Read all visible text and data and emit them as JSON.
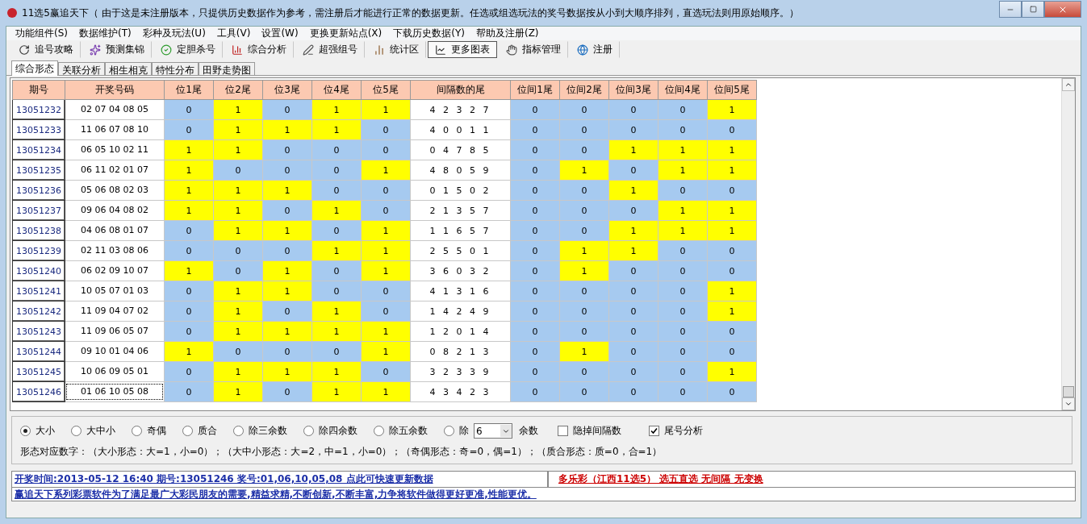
{
  "window": {
    "title": "11选5赢追天下（ 由于这是未注册版本，只提供历史数据作为参考，需注册后才能进行正常的数据更新。任选或组选玩法的奖号数据按从小到大顺序排列，直选玩法则用原始顺序。）"
  },
  "menu": [
    "功能组件(S)",
    "数据维护(T)",
    "彩种及玩法(U)",
    "工具(V)",
    "设置(W)",
    "更换更新站点(X)",
    "下载历史数据(Y)",
    "帮助及注册(Z)"
  ],
  "toolbar": [
    {
      "label": "追号攻略",
      "kind": "refresh",
      "pressed": false
    },
    {
      "label": "预测集锦",
      "kind": "scatter",
      "pressed": false
    },
    {
      "label": "定胆杀号",
      "kind": "check",
      "pressed": false
    },
    {
      "label": "综合分析",
      "kind": "bars",
      "pressed": false
    },
    {
      "label": "超强组号",
      "kind": "pen",
      "pressed": false
    },
    {
      "label": "统计区",
      "kind": "stats",
      "pressed": false
    },
    {
      "label": "更多图表",
      "kind": "chart",
      "pressed": true
    },
    {
      "label": "指标管理",
      "kind": "hand",
      "pressed": false
    },
    {
      "label": "注册",
      "kind": "globe",
      "pressed": false
    }
  ],
  "tabs": [
    {
      "label": "综合形态",
      "selected": true
    },
    {
      "label": "关联分析",
      "selected": false
    },
    {
      "label": "相生相克",
      "selected": false
    },
    {
      "label": "特性分布",
      "selected": false
    },
    {
      "label": "田野走势图",
      "selected": false
    }
  ],
  "table": {
    "columns": [
      "期号",
      "开奖号码",
      "位1尾",
      "位2尾",
      "位3尾",
      "位4尾",
      "位5尾",
      "间隔数的尾",
      "位间1尾",
      "位间2尾",
      "位间3尾",
      "位间4尾",
      "位间5尾"
    ],
    "rows": [
      {
        "period": "13051232",
        "numbers": "02 07 04 08 05",
        "focused": false,
        "tails": [
          {
            "value": "0",
            "hit": false
          },
          {
            "value": "1",
            "hit": true
          },
          {
            "value": "0",
            "hit": false
          },
          {
            "value": "1",
            "hit": true
          },
          {
            "value": "1",
            "hit": true
          }
        ],
        "gaps": "4 2 3 2 7",
        "gap_tails": [
          {
            "value": "0",
            "hit": false
          },
          {
            "value": "0",
            "hit": false
          },
          {
            "value": "0",
            "hit": false
          },
          {
            "value": "0",
            "hit": false
          },
          {
            "value": "1",
            "hit": true
          }
        ]
      },
      {
        "period": "13051233",
        "numbers": "11 06 07 08 10",
        "focused": false,
        "tails": [
          {
            "value": "0",
            "hit": false
          },
          {
            "value": "1",
            "hit": true
          },
          {
            "value": "1",
            "hit": true
          },
          {
            "value": "1",
            "hit": true
          },
          {
            "value": "0",
            "hit": false
          }
        ],
        "gaps": "4 0 0 1 1",
        "gap_tails": [
          {
            "value": "0",
            "hit": false
          },
          {
            "value": "0",
            "hit": false
          },
          {
            "value": "0",
            "hit": false
          },
          {
            "value": "0",
            "hit": false
          },
          {
            "value": "0",
            "hit": false
          }
        ]
      },
      {
        "period": "13051234",
        "numbers": "06 05 10 02 11",
        "focused": false,
        "tails": [
          {
            "value": "1",
            "hit": true
          },
          {
            "value": "1",
            "hit": true
          },
          {
            "value": "0",
            "hit": false
          },
          {
            "value": "0",
            "hit": false
          },
          {
            "value": "0",
            "hit": false
          }
        ],
        "gaps": "0 4 7 8 5",
        "gap_tails": [
          {
            "value": "0",
            "hit": false
          },
          {
            "value": "0",
            "hit": false
          },
          {
            "value": "1",
            "hit": true
          },
          {
            "value": "1",
            "hit": true
          },
          {
            "value": "1",
            "hit": true
          }
        ]
      },
      {
        "period": "13051235",
        "numbers": "06 11 02 01 07",
        "focused": false,
        "tails": [
          {
            "value": "1",
            "hit": true
          },
          {
            "value": "0",
            "hit": false
          },
          {
            "value": "0",
            "hit": false
          },
          {
            "value": "0",
            "hit": false
          },
          {
            "value": "1",
            "hit": true
          }
        ],
        "gaps": "4 8 0 5 9",
        "gap_tails": [
          {
            "value": "0",
            "hit": false
          },
          {
            "value": "1",
            "hit": true
          },
          {
            "value": "0",
            "hit": false
          },
          {
            "value": "1",
            "hit": true
          },
          {
            "value": "1",
            "hit": true
          }
        ]
      },
      {
        "period": "13051236",
        "numbers": "05 06 08 02 03",
        "focused": false,
        "tails": [
          {
            "value": "1",
            "hit": true
          },
          {
            "value": "1",
            "hit": true
          },
          {
            "value": "1",
            "hit": true
          },
          {
            "value": "0",
            "hit": false
          },
          {
            "value": "0",
            "hit": false
          }
        ],
        "gaps": "0 1 5 0 2",
        "gap_tails": [
          {
            "value": "0",
            "hit": false
          },
          {
            "value": "0",
            "hit": false
          },
          {
            "value": "1",
            "hit": true
          },
          {
            "value": "0",
            "hit": false
          },
          {
            "value": "0",
            "hit": false
          }
        ]
      },
      {
        "period": "13051237",
        "numbers": "09 06 04 08 02",
        "focused": false,
        "tails": [
          {
            "value": "1",
            "hit": true
          },
          {
            "value": "1",
            "hit": true
          },
          {
            "value": "0",
            "hit": false
          },
          {
            "value": "1",
            "hit": true
          },
          {
            "value": "0",
            "hit": false
          }
        ],
        "gaps": "2 1 3 5 7",
        "gap_tails": [
          {
            "value": "0",
            "hit": false
          },
          {
            "value": "0",
            "hit": false
          },
          {
            "value": "0",
            "hit": false
          },
          {
            "value": "1",
            "hit": true
          },
          {
            "value": "1",
            "hit": true
          }
        ]
      },
      {
        "period": "13051238",
        "numbers": "04 06 08 01 07",
        "focused": false,
        "tails": [
          {
            "value": "0",
            "hit": false
          },
          {
            "value": "1",
            "hit": true
          },
          {
            "value": "1",
            "hit": true
          },
          {
            "value": "0",
            "hit": false
          },
          {
            "value": "1",
            "hit": true
          }
        ],
        "gaps": "1 1 6 5 7",
        "gap_tails": [
          {
            "value": "0",
            "hit": false
          },
          {
            "value": "0",
            "hit": false
          },
          {
            "value": "1",
            "hit": true
          },
          {
            "value": "1",
            "hit": true
          },
          {
            "value": "1",
            "hit": true
          }
        ]
      },
      {
        "period": "13051239",
        "numbers": "02 11 03 08 06",
        "focused": false,
        "tails": [
          {
            "value": "0",
            "hit": false
          },
          {
            "value": "0",
            "hit": false
          },
          {
            "value": "0",
            "hit": false
          },
          {
            "value": "1",
            "hit": true
          },
          {
            "value": "1",
            "hit": true
          }
        ],
        "gaps": "2 5 5 0 1",
        "gap_tails": [
          {
            "value": "0",
            "hit": false
          },
          {
            "value": "1",
            "hit": true
          },
          {
            "value": "1",
            "hit": true
          },
          {
            "value": "0",
            "hit": false
          },
          {
            "value": "0",
            "hit": false
          }
        ]
      },
      {
        "period": "13051240",
        "numbers": "06 02 09 10 07",
        "focused": false,
        "tails": [
          {
            "value": "1",
            "hit": true
          },
          {
            "value": "0",
            "hit": false
          },
          {
            "value": "1",
            "hit": true
          },
          {
            "value": "0",
            "hit": false
          },
          {
            "value": "1",
            "hit": true
          }
        ],
        "gaps": "3 6 0 3 2",
        "gap_tails": [
          {
            "value": "0",
            "hit": false
          },
          {
            "value": "1",
            "hit": true
          },
          {
            "value": "0",
            "hit": false
          },
          {
            "value": "0",
            "hit": false
          },
          {
            "value": "0",
            "hit": false
          }
        ]
      },
      {
        "period": "13051241",
        "numbers": "10 05 07 01 03",
        "focused": false,
        "tails": [
          {
            "value": "0",
            "hit": false
          },
          {
            "value": "1",
            "hit": true
          },
          {
            "value": "1",
            "hit": true
          },
          {
            "value": "0",
            "hit": false
          },
          {
            "value": "0",
            "hit": false
          }
        ],
        "gaps": "4 1 3 1 6",
        "gap_tails": [
          {
            "value": "0",
            "hit": false
          },
          {
            "value": "0",
            "hit": false
          },
          {
            "value": "0",
            "hit": false
          },
          {
            "value": "0",
            "hit": false
          },
          {
            "value": "1",
            "hit": true
          }
        ]
      },
      {
        "period": "13051242",
        "numbers": "11 09 04 07 02",
        "focused": false,
        "tails": [
          {
            "value": "0",
            "hit": false
          },
          {
            "value": "1",
            "hit": true
          },
          {
            "value": "0",
            "hit": false
          },
          {
            "value": "1",
            "hit": true
          },
          {
            "value": "0",
            "hit": false
          }
        ],
        "gaps": "1 4 2 4 9",
        "gap_tails": [
          {
            "value": "0",
            "hit": false
          },
          {
            "value": "0",
            "hit": false
          },
          {
            "value": "0",
            "hit": false
          },
          {
            "value": "0",
            "hit": false
          },
          {
            "value": "1",
            "hit": true
          }
        ]
      },
      {
        "period": "13051243",
        "numbers": "11 09 06 05 07",
        "focused": false,
        "tails": [
          {
            "value": "0",
            "hit": false
          },
          {
            "value": "1",
            "hit": true
          },
          {
            "value": "1",
            "hit": true
          },
          {
            "value": "1",
            "hit": true
          },
          {
            "value": "1",
            "hit": true
          }
        ],
        "gaps": "1 2 0 1 4",
        "gap_tails": [
          {
            "value": "0",
            "hit": false
          },
          {
            "value": "0",
            "hit": false
          },
          {
            "value": "0",
            "hit": false
          },
          {
            "value": "0",
            "hit": false
          },
          {
            "value": "0",
            "hit": false
          }
        ]
      },
      {
        "period": "13051244",
        "numbers": "09 10 01 04 06",
        "focused": false,
        "tails": [
          {
            "value": "1",
            "hit": true
          },
          {
            "value": "0",
            "hit": false
          },
          {
            "value": "0",
            "hit": false
          },
          {
            "value": "0",
            "hit": false
          },
          {
            "value": "1",
            "hit": true
          }
        ],
        "gaps": "0 8 2 1 3",
        "gap_tails": [
          {
            "value": "0",
            "hit": false
          },
          {
            "value": "1",
            "hit": true
          },
          {
            "value": "0",
            "hit": false
          },
          {
            "value": "0",
            "hit": false
          },
          {
            "value": "0",
            "hit": false
          }
        ]
      },
      {
        "period": "13051245",
        "numbers": "10 06 09 05 01",
        "focused": false,
        "tails": [
          {
            "value": "0",
            "hit": false
          },
          {
            "value": "1",
            "hit": true
          },
          {
            "value": "1",
            "hit": true
          },
          {
            "value": "1",
            "hit": true
          },
          {
            "value": "0",
            "hit": false
          }
        ],
        "gaps": "3 2 3 3 9",
        "gap_tails": [
          {
            "value": "0",
            "hit": false
          },
          {
            "value": "0",
            "hit": false
          },
          {
            "value": "0",
            "hit": false
          },
          {
            "value": "0",
            "hit": false
          },
          {
            "value": "1",
            "hit": true
          }
        ]
      },
      {
        "period": "13051246",
        "numbers": "01 06 10 05 08",
        "focused": true,
        "tails": [
          {
            "value": "0",
            "hit": false
          },
          {
            "value": "1",
            "hit": true
          },
          {
            "value": "0",
            "hit": false
          },
          {
            "value": "1",
            "hit": true
          },
          {
            "value": "1",
            "hit": true
          }
        ],
        "gaps": "4 3 4 2 3",
        "gap_tails": [
          {
            "value": "0",
            "hit": false
          },
          {
            "value": "0",
            "hit": false
          },
          {
            "value": "0",
            "hit": false
          },
          {
            "value": "0",
            "hit": false
          },
          {
            "value": "0",
            "hit": false
          }
        ]
      }
    ]
  },
  "options": {
    "radios": [
      {
        "label": "大小",
        "selected": true
      },
      {
        "label": "大中小",
        "selected": false
      },
      {
        "label": "奇偶",
        "selected": false
      },
      {
        "label": "质合",
        "selected": false
      },
      {
        "label": "除三余数",
        "selected": false
      },
      {
        "label": "除四余数",
        "selected": false
      },
      {
        "label": "除五余数",
        "selected": false
      }
    ],
    "divisor": {
      "label": "除",
      "selected": false,
      "value": "6",
      "suffix": "余数"
    },
    "checkboxes": [
      {
        "label": "隐掉间隔数",
        "checked": false
      },
      {
        "label": "尾号分析",
        "checked": true
      }
    ],
    "legend": "形态对应数字：（大小形态：大=1，小=0）；（大中小形态：大=2，中=1，小=0）；（奇偶形态：奇=0，偶=1）；（质合形态：质=0，合=1）"
  },
  "status_bar": {
    "latest": "开奖时间:2013-05-12 16:40 期号:13051246 奖号:01,06,10,05,08 点此可快速更新数据",
    "mode": "多乐彩（江西11选5） 选五直选 无间隔 无变换"
  },
  "ticker": "赢追天下系列彩票软件为了满足最广大彩民朋友的需要,精益求精,不断创新,不断丰富,力争将软件做得更好更准,性能更优。"
}
